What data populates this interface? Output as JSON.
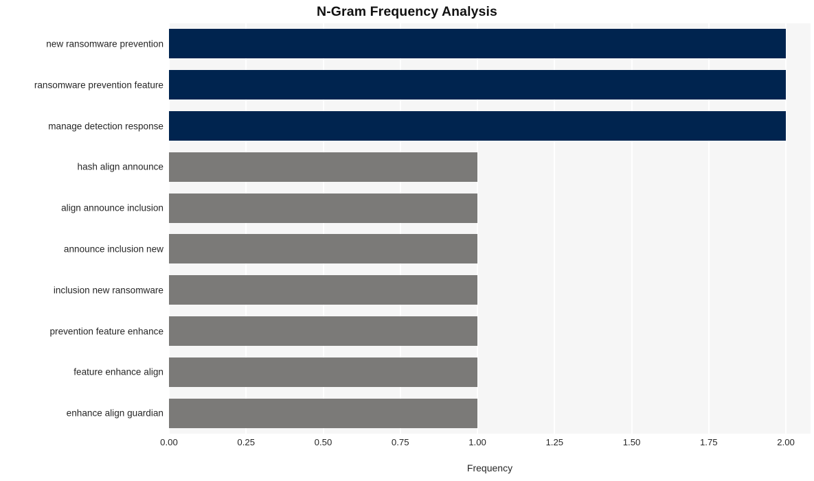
{
  "chart_data": {
    "type": "bar",
    "orientation": "horizontal",
    "title": "N-Gram Frequency Analysis",
    "xlabel": "Frequency",
    "ylabel": "",
    "xlim": [
      0,
      2.08
    ],
    "ylim": null,
    "grid": true,
    "legend": null,
    "xticks": [
      "0.00",
      "0.25",
      "0.50",
      "0.75",
      "1.00",
      "1.25",
      "1.50",
      "1.75",
      "2.00"
    ],
    "xtick_values": [
      0,
      0.25,
      0.5,
      0.75,
      1.0,
      1.25,
      1.5,
      1.75,
      2.0
    ],
    "categories": [
      "new ransomware prevention",
      "ransomware prevention feature",
      "manage detection response",
      "hash align announce",
      "align announce inclusion",
      "announce inclusion new",
      "inclusion new ransomware",
      "prevention feature enhance",
      "feature enhance align",
      "enhance align guardian"
    ],
    "values": [
      2,
      2,
      2,
      1,
      1,
      1,
      1,
      1,
      1,
      1
    ],
    "bar_colors": [
      "#00244f",
      "#00244f",
      "#00244f",
      "#7b7a78",
      "#7b7a78",
      "#7b7a78",
      "#7b7a78",
      "#7b7a78",
      "#7b7a78",
      "#7b7a78"
    ],
    "colors": {
      "high_frequency": "#00244f",
      "low_frequency": "#7b7a78",
      "plot_background": "#f6f6f6",
      "gridline": "#ffffff",
      "figure_background": "#ffffff",
      "text": "#262626",
      "title_text": "#111111"
    }
  }
}
